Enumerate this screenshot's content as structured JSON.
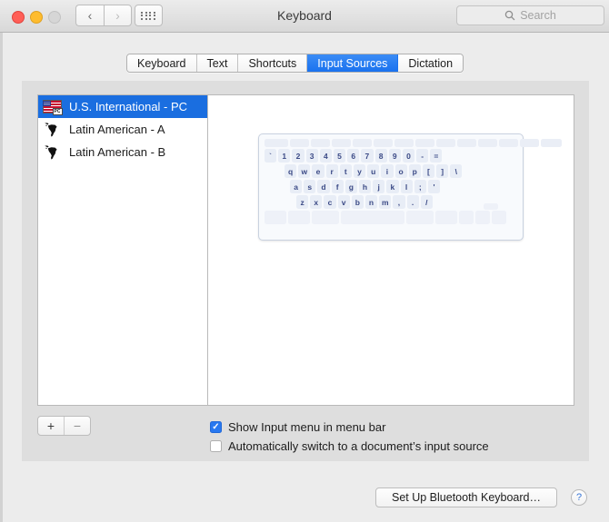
{
  "window": {
    "title": "Keyboard",
    "traffic_lights": [
      "close",
      "minimize",
      "zoom"
    ],
    "nav": {
      "back": "‹",
      "forward": "›"
    },
    "show_all_icon": "grid-icon"
  },
  "search": {
    "placeholder": "Search",
    "icon": "search-icon",
    "value": ""
  },
  "tabs": [
    {
      "label": "Keyboard",
      "active": false
    },
    {
      "label": "Text",
      "active": false
    },
    {
      "label": "Shortcuts",
      "active": false
    },
    {
      "label": "Input Sources",
      "active": true
    },
    {
      "label": "Dictation",
      "active": false
    }
  ],
  "input_sources": [
    {
      "label": "U.S. International - PC",
      "icon": "us-flag-pc-icon",
      "selected": true
    },
    {
      "label": "Latin American - A",
      "icon": "latin-america-icon",
      "selected": false
    },
    {
      "label": "Latin American - B",
      "icon": "latin-america-icon",
      "selected": false
    }
  ],
  "list_controls": {
    "add_label": "+",
    "remove_label": "−"
  },
  "keyboard_preview": {
    "rows": [
      {
        "name": "function-row",
        "keys": [
          "",
          "",
          "",
          "",
          "",
          "",
          "",
          "",
          "",
          ""
        ]
      },
      {
        "name": "number-row",
        "keys": [
          "`",
          "1",
          "2",
          "3",
          "4",
          "5",
          "6",
          "7",
          "8",
          "9",
          "0",
          "-",
          "="
        ]
      },
      {
        "name": "top-letter-row",
        "keys": [
          "q",
          "w",
          "e",
          "r",
          "t",
          "y",
          "u",
          "i",
          "o",
          "p",
          "[",
          "]",
          "\\"
        ]
      },
      {
        "name": "home-letter-row",
        "keys": [
          "a",
          "s",
          "d",
          "f",
          "g",
          "h",
          "j",
          "k",
          "l",
          ";",
          "'"
        ]
      },
      {
        "name": "bottom-letter-row",
        "keys": [
          "z",
          "x",
          "c",
          "v",
          "b",
          "n",
          "m",
          ",",
          ".",
          "/"
        ]
      },
      {
        "name": "modifier-row",
        "keys": [
          "",
          "",
          "",
          "",
          "",
          "",
          "",
          "",
          ""
        ]
      }
    ]
  },
  "checkboxes": [
    {
      "label": "Show Input menu in menu bar",
      "checked": true
    },
    {
      "label": "Automatically switch to a document’s input source",
      "checked": false
    }
  ],
  "buttons": {
    "bluetooth": "Set Up Bluetooth Keyboard…",
    "help": "?"
  },
  "colors": {
    "accent_blue": "#1a6ee0",
    "tab_active_blue": "#1a72ef",
    "checkbox_blue": "#2878f0",
    "key_face": "#e8edf6",
    "key_text": "#3b4a86",
    "window_bg": "#ececec",
    "panel_bg": "#dedede"
  }
}
